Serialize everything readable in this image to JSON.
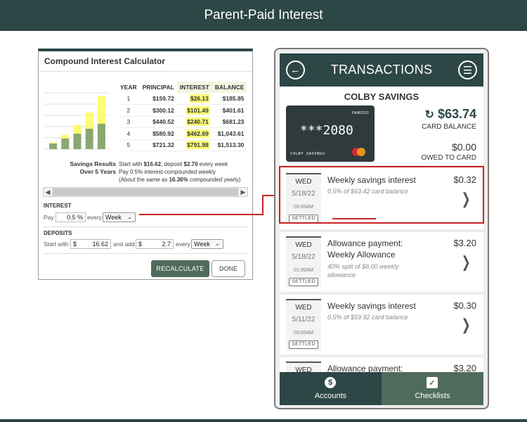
{
  "header": {
    "title": "Parent-Paid Interest"
  },
  "calculator": {
    "title": "Compound Interest Calculator",
    "table": {
      "columns": [
        "YEAR",
        "PRINCIPAL",
        "INTEREST",
        "BALANCE"
      ],
      "rows": [
        {
          "year": "1",
          "principal": "$159.72",
          "interest": "$26.13",
          "balance": "$185.85"
        },
        {
          "year": "2",
          "principal": "$300.12",
          "interest": "$101.49",
          "balance": "$401.61"
        },
        {
          "year": "3",
          "principal": "$440.52",
          "interest": "$240.71",
          "balance": "$681.23"
        },
        {
          "year": "4",
          "principal": "$580.92",
          "interest": "$462.69",
          "balance": "$1,043.61"
        },
        {
          "year": "5",
          "principal": "$721.32",
          "interest": "$791.98",
          "balance": "$1,513.30"
        }
      ]
    },
    "summary_title_1": "Savings Results",
    "summary_title_2": "Over 5 Years",
    "summary_line1_a": "Start with ",
    "summary_line1_b": "$16.62",
    "summary_line1_c": ", deposit ",
    "summary_line1_d": "$2.70",
    "summary_line1_e": " every week",
    "summary_line2": "Pay 0.5% interest compounded weekly",
    "summary_line3_a": "(About the same as ",
    "summary_line3_b": "16.36%",
    "summary_line3_c": " compounded yearly)",
    "interest_label": "INTEREST",
    "pay_label": "Pay",
    "pay_value": "0.5 %",
    "every_label": "every",
    "interest_period": "Week",
    "deposits_label": "DEPOSITS",
    "start_with_label": "Start with",
    "start_value": "16.62",
    "and_add_label": "and add",
    "add_value": "2.7",
    "deposit_every_label": "every",
    "deposit_period": "Week",
    "currency": "$",
    "recalculate_label": "RECALCULATE",
    "done_label": "DONE"
  },
  "phone": {
    "title": "TRANSACTIONS",
    "account_name": "COLBY SAVINGS",
    "card": {
      "brand": "FAMZOO",
      "number": "***2080",
      "holder": "COLBY SAVINGS"
    },
    "card_balance": "$63.74",
    "card_balance_label": "CARD BALANCE",
    "owed_amount": "$0.00",
    "owed_label": "OWED TO CARD",
    "transactions": [
      {
        "day": "WED",
        "date": "5/18/22",
        "time": "03:00AM",
        "status": "SETTLED",
        "title": "Weekly savings interest",
        "subtitle": "0.5% of $63.42 card balance",
        "amount": "$0.32"
      },
      {
        "day": "WED",
        "date": "5/18/22",
        "time": "01:00AM",
        "status": "SETTLED",
        "title": "Allowance payment: Weekly Allowance",
        "subtitle": "40% split of $8.00 weekly allowance",
        "amount": "$3.20"
      },
      {
        "day": "WED",
        "date": "5/11/22",
        "time": "03:00AM",
        "status": "SETTLED",
        "title": "Weekly savings interest",
        "subtitle": "0.5% of $59.92 card balance",
        "amount": "$0.30"
      },
      {
        "day": "WED",
        "date": "",
        "time": "",
        "status": "",
        "title": "Allowance payment:",
        "subtitle": "",
        "amount": "$3.20"
      }
    ],
    "nav": {
      "accounts": "Accounts",
      "checklists": "Checklists"
    }
  },
  "chart_data": {
    "type": "bar",
    "categories": [
      "1",
      "2",
      "3",
      "4",
      "5"
    ],
    "series": [
      {
        "name": "PRINCIPAL",
        "values": [
          159.72,
          300.12,
          440.52,
          580.92,
          721.32
        ]
      },
      {
        "name": "INTEREST",
        "values": [
          26.13,
          101.49,
          240.71,
          462.69,
          791.98
        ]
      }
    ],
    "stacked": true,
    "ylim": [
      0,
      1600
    ],
    "colors": {
      "PRINCIPAL": "#8aa870",
      "INTEREST": "#fbfb74"
    }
  },
  "colors": {
    "brand": "#2d4646",
    "accent": "#4f6b5c",
    "highlight": "#cc2222"
  }
}
